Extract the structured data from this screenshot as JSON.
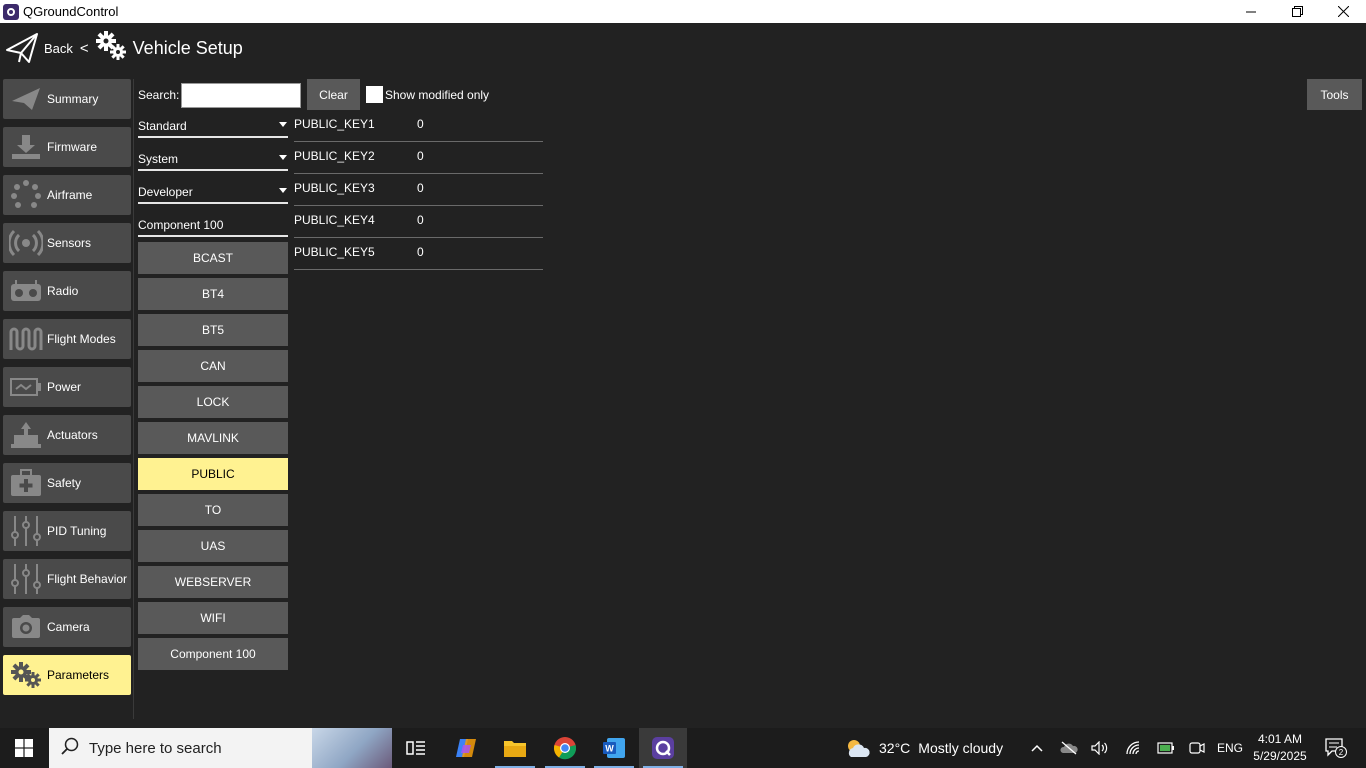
{
  "window": {
    "title": "QGroundControl",
    "controls": [
      "minimize",
      "restore",
      "close"
    ]
  },
  "header": {
    "back_label": "Back",
    "separator": "<",
    "page_title": "Vehicle Setup"
  },
  "sidebar": {
    "items": [
      {
        "label": "Summary",
        "icon": "paper-plane-icon"
      },
      {
        "label": "Firmware",
        "icon": "download-icon"
      },
      {
        "label": "Airframe",
        "icon": "airframe-icon"
      },
      {
        "label": "Sensors",
        "icon": "sensors-icon"
      },
      {
        "label": "Radio",
        "icon": "radio-icon"
      },
      {
        "label": "Flight Modes",
        "icon": "wave-icon"
      },
      {
        "label": "Power",
        "icon": "battery-icon"
      },
      {
        "label": "Actuators",
        "icon": "actuator-icon"
      },
      {
        "label": "Safety",
        "icon": "medkit-icon"
      },
      {
        "label": "PID Tuning",
        "icon": "sliders-icon"
      },
      {
        "label": "Flight Behavior",
        "icon": "sliders-icon"
      },
      {
        "label": "Camera",
        "icon": "camera-icon"
      },
      {
        "label": "Parameters",
        "icon": "gears-icon",
        "active": true
      }
    ]
  },
  "search": {
    "label": "Search:",
    "value": "",
    "placeholder": "",
    "clear_label": "Clear",
    "show_modified_label": "Show modified only",
    "show_modified_checked": false
  },
  "tools_label": "Tools",
  "dropdowns": [
    {
      "label": "Standard",
      "has_caret": true
    },
    {
      "label": "System",
      "has_caret": true
    },
    {
      "label": "Developer",
      "has_caret": true
    },
    {
      "label": "Component 100",
      "has_caret": false
    }
  ],
  "groups": [
    {
      "label": "BCAST"
    },
    {
      "label": "BT4"
    },
    {
      "label": "BT5"
    },
    {
      "label": "CAN"
    },
    {
      "label": "LOCK"
    },
    {
      "label": "MAVLINK"
    },
    {
      "label": "PUBLIC",
      "active": true
    },
    {
      "label": "TO"
    },
    {
      "label": "UAS"
    },
    {
      "label": "WEBSERVER"
    },
    {
      "label": "WIFI"
    },
    {
      "label": "Component 100"
    }
  ],
  "params": [
    {
      "name": "PUBLIC_KEY1",
      "value": "0"
    },
    {
      "name": "PUBLIC_KEY2",
      "value": "0"
    },
    {
      "name": "PUBLIC_KEY3",
      "value": "0"
    },
    {
      "name": "PUBLIC_KEY4",
      "value": "0"
    },
    {
      "name": "PUBLIC_KEY5",
      "value": "0"
    }
  ],
  "taskbar": {
    "search_placeholder": "Type here to search",
    "apps": [
      "task-view-icon",
      "copilot-icon",
      "file-explorer-icon",
      "chrome-icon",
      "word-icon",
      "qgroundcontrol-icon"
    ],
    "weather_temp": "32°C",
    "weather_desc": "Mostly cloudy",
    "language": "ENG",
    "time": "4:01 AM",
    "date": "5/29/2025",
    "notification_count": "2"
  },
  "colors": {
    "background": "#222222",
    "button": "#595959",
    "sidebar_button": "#4a4a4a",
    "active_highlight": "#fff291"
  }
}
